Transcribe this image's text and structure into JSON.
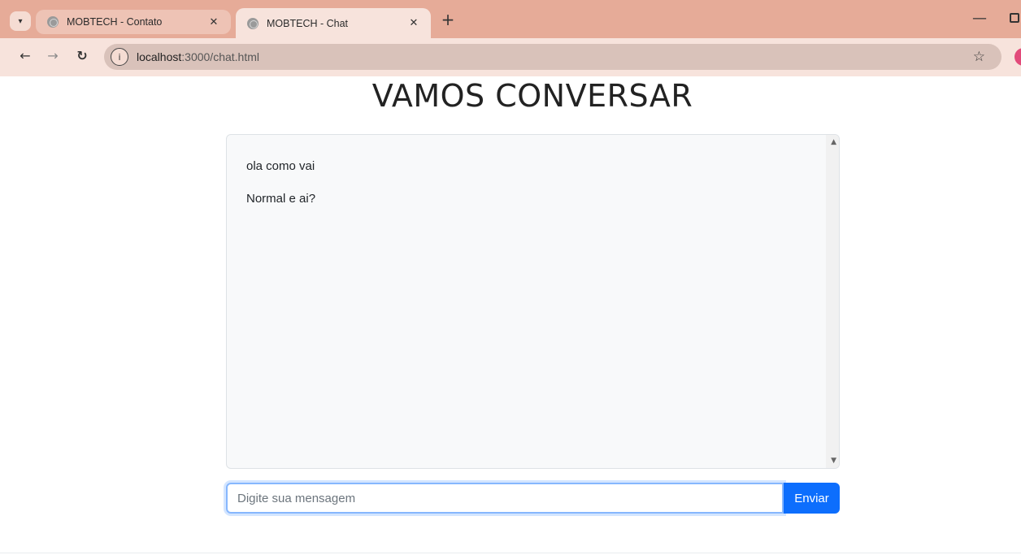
{
  "browser": {
    "tabs": [
      {
        "title": "MOBTECH - Contato",
        "active": false
      },
      {
        "title": "MOBTECH - Chat",
        "active": true
      }
    ],
    "close_glyph": "✕",
    "new_tab_glyph": "+",
    "url_host": "localhost",
    "url_path": ":3000/chat.html"
  },
  "page": {
    "title": "VAMOS CONVERSAR",
    "messages": [
      "ola como vai",
      "Normal e ai?"
    ],
    "input_placeholder": "Digite sua mensagem",
    "send_label": "Enviar"
  },
  "colors": {
    "tabstrip": "#e6ab98",
    "toolbar": "#f7e3dc",
    "primary": "#0d6efd"
  }
}
